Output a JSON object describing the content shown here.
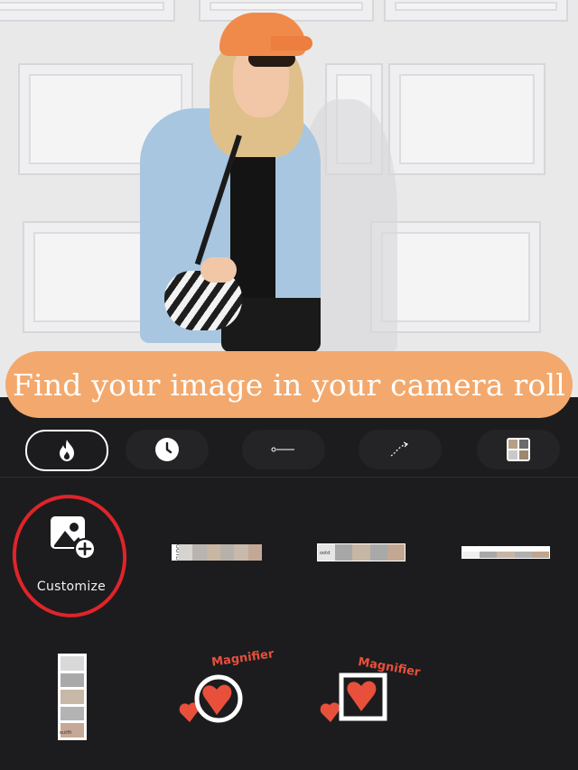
{
  "banner": {
    "text": "Find your image in your camera roll"
  },
  "toolbar": {
    "tabs": [
      {
        "name": "popular",
        "icon": "flame-icon",
        "active": true
      },
      {
        "name": "recent",
        "icon": "clock-icon",
        "active": false
      },
      {
        "name": "lines",
        "icon": "line-icon",
        "active": false
      },
      {
        "name": "arrows",
        "icon": "arrow-curve-icon",
        "active": false
      },
      {
        "name": "collage",
        "icon": "grid-icon",
        "active": false
      }
    ]
  },
  "stickers": {
    "customize_label": "Customize",
    "palette1": {
      "tag": "OOTD",
      "colors": [
        "#d7d3cf",
        "#b9b4af",
        "#c9b7a4",
        "#b7b1ab",
        "#c8b9ad",
        "#c4a895"
      ]
    },
    "palette2": {
      "tag": "ootd",
      "colors": [
        "#e5e5e5",
        "#a7a7a7",
        "#c6b6a4",
        "#a9a9a9",
        "#c2a793"
      ]
    },
    "palette3": {
      "colors": [
        "#efefef",
        "#a8a8a8",
        "#c8b6a3",
        "#b0b0b0",
        "#c0a58f"
      ]
    },
    "vertical_palette": {
      "tag": "outfit",
      "colors": [
        "#d9d9d9",
        "#a9a9a9",
        "#c7b8a8",
        "#b3b3b3",
        "#c5a895"
      ]
    },
    "magnifier1": "Magnifier",
    "magnifier2": "Magnifier"
  },
  "colors": {
    "accent": "#f3a96d",
    "highlight": "#e0242a",
    "sticker_red": "#e8503c"
  }
}
